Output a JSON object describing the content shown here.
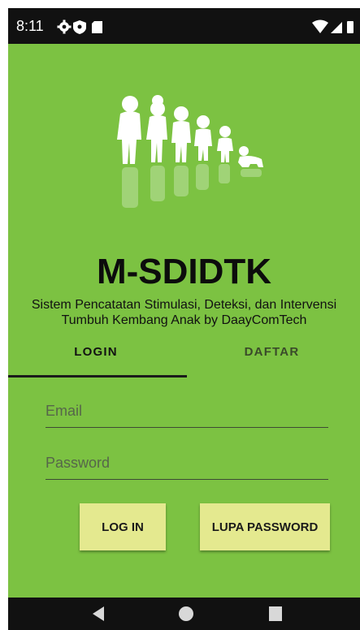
{
  "status_bar": {
    "time": "8:11",
    "icons": [
      "gear-icon",
      "shield-icon",
      "sd-card-icon",
      "wifi-icon",
      "signal-icon",
      "battery-icon"
    ]
  },
  "app": {
    "title": "M-SDIDTK",
    "subtitle_line1": "Sistem Pencatatan Stimulasi, Deteksi, dan Intervensi",
    "subtitle_line2": "Tumbuh Kembang Anak by DaayComTech",
    "background_color": "#7cc242"
  },
  "tabs": [
    {
      "label": "LOGIN",
      "active": true
    },
    {
      "label": "DAFTAR",
      "active": false
    }
  ],
  "form": {
    "email_placeholder": "Email",
    "password_placeholder": "Password",
    "login_button": "LOG IN",
    "forgot_button": "LUPA PASSWORD",
    "button_color": "#e4e98f"
  },
  "nav_bar": {
    "icons": [
      "back-icon",
      "home-icon",
      "recents-icon"
    ]
  }
}
